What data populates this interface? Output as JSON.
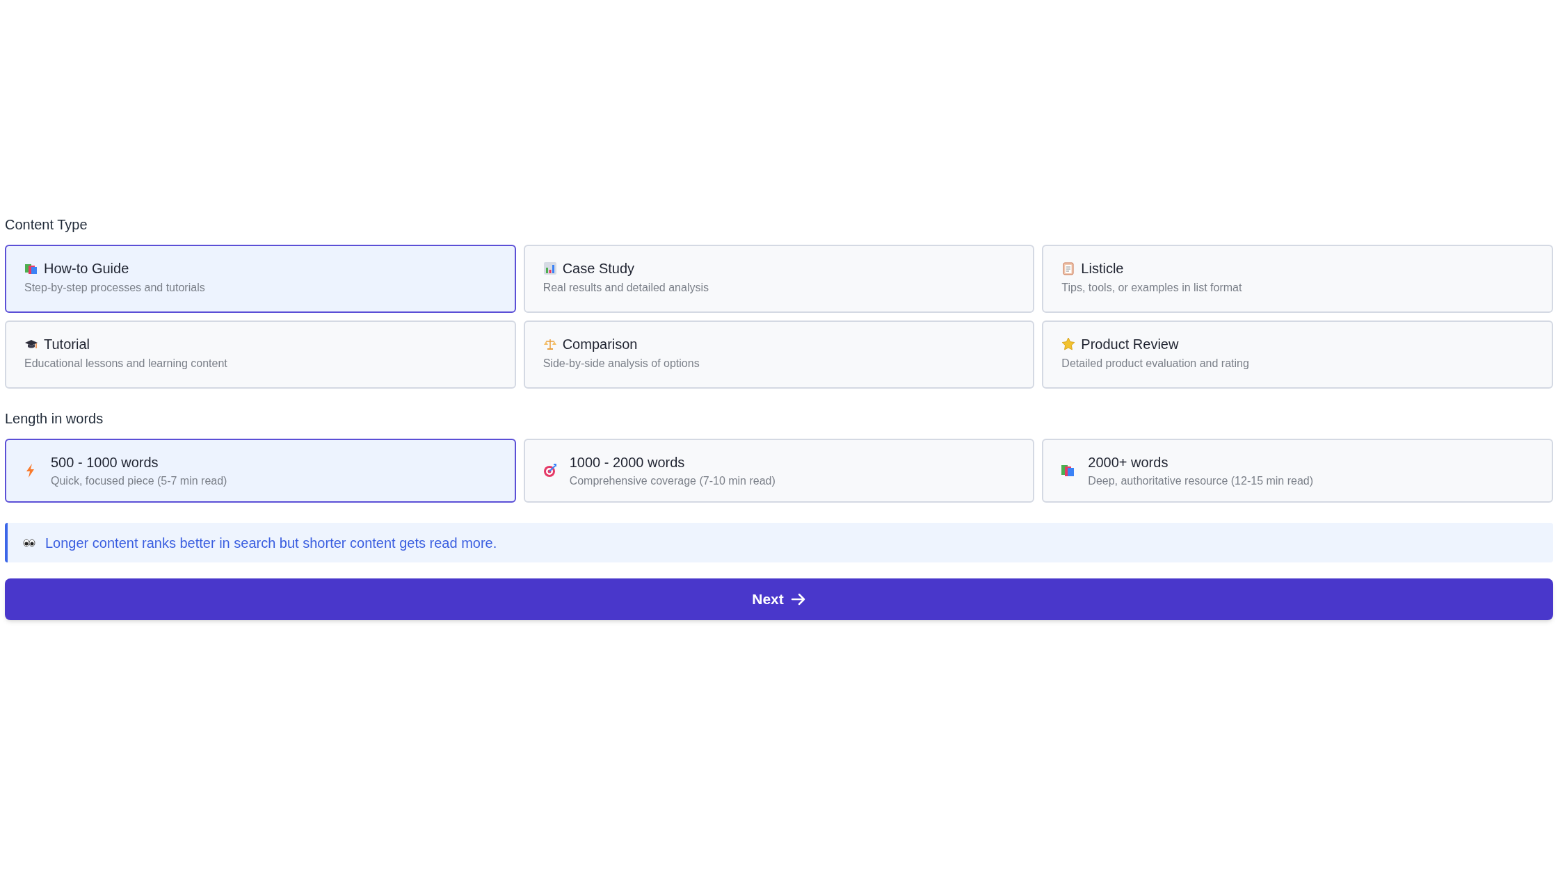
{
  "content_type": {
    "label": "Content Type",
    "options": [
      {
        "title": "How-to Guide",
        "description": "Step-by-step processes and tutorials",
        "selected": true
      },
      {
        "title": "Case Study",
        "description": "Real results and detailed analysis",
        "selected": false
      },
      {
        "title": "Listicle",
        "description": "Tips, tools, or examples in list format",
        "selected": false
      },
      {
        "title": "Tutorial",
        "description": "Educational lessons and learning content",
        "selected": false
      },
      {
        "title": "Comparison",
        "description": "Side-by-side analysis of options",
        "selected": false
      },
      {
        "title": "Product Review",
        "description": "Detailed product evaluation and rating",
        "selected": false
      }
    ]
  },
  "length": {
    "label": "Length in words",
    "options": [
      {
        "title": "500 - 1000 words",
        "description": "Quick, focused piece (5-7 min read)",
        "selected": true
      },
      {
        "title": "1000 - 2000 words",
        "description": "Comprehensive coverage (7-10 min read)",
        "selected": false
      },
      {
        "title": "2000+ words",
        "description": "Deep, authoritative resource (12-15 min read)",
        "selected": false
      }
    ]
  },
  "tip": "Longer content ranks better in search but shorter content gets read more.",
  "next_button": "Next"
}
